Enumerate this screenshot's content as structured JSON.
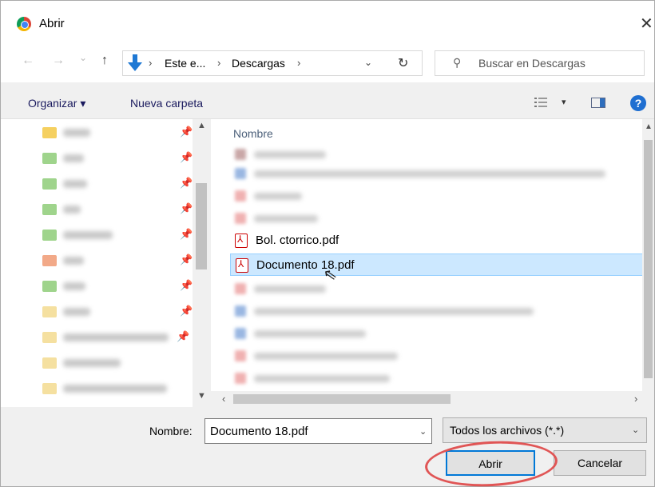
{
  "window": {
    "title": "Abrir",
    "close_label": "✕"
  },
  "nav": {
    "back": "←",
    "forward": "→",
    "recent": "⌄",
    "up": "↑",
    "address": {
      "seg1": "Este e...",
      "seg2": "Descargas",
      "sep": "›"
    },
    "refresh": "↻",
    "search_placeholder": "Buscar en Descargas"
  },
  "toolbar": {
    "organize": "Organizar ▾",
    "new_folder": "Nueva carpeta",
    "view_dd": "▾",
    "help": "?"
  },
  "files": {
    "column_name": "Nombre",
    "visible_items": [
      {
        "name": "Bol. ctorrico.pdf",
        "selected": false
      },
      {
        "name": "Documento 18.pdf",
        "selected": true
      }
    ]
  },
  "bottom": {
    "name_label": "Nombre:",
    "name_value": "Documento 18.pdf",
    "file_type": "Todos los archivos (*.*)",
    "open_label": "Abrir",
    "cancel_label": "Cancelar"
  },
  "colors": {
    "accent": "#0078d7",
    "selection": "#cce8ff",
    "highlight_ring": "#e05555"
  }
}
